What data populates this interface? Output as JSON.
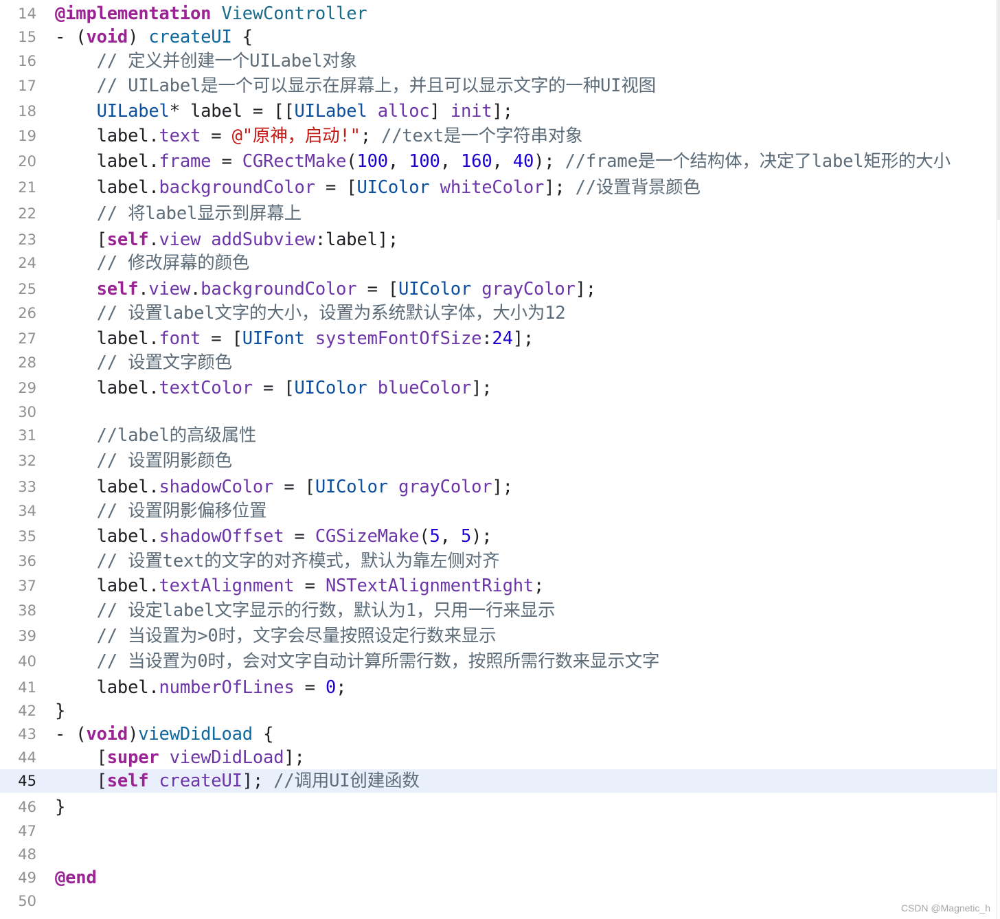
{
  "editor": {
    "lines": [
      {
        "number": "14",
        "tokens": [
          {
            "t": "@implementation",
            "c": "keyword"
          },
          {
            "t": " "
          },
          {
            "t": "ViewController",
            "c": "class"
          }
        ]
      },
      {
        "number": "15",
        "tokens": [
          {
            "t": "- ("
          },
          {
            "t": "void",
            "c": "keyword"
          },
          {
            "t": ") "
          },
          {
            "t": "createUI",
            "c": "decl"
          },
          {
            "t": " {"
          }
        ]
      },
      {
        "number": "16",
        "tokens": [
          {
            "t": "    "
          },
          {
            "t": "// 定义并创建一个UILabel对象",
            "c": "comment"
          }
        ]
      },
      {
        "number": "17",
        "tokens": [
          {
            "t": "    "
          },
          {
            "t": "// UILabel是一个可以显示在屏幕上，并且可以显示文字的一种UI视图",
            "c": "comment"
          }
        ]
      },
      {
        "number": "18",
        "tokens": [
          {
            "t": "    "
          },
          {
            "t": "UILabel",
            "c": "type"
          },
          {
            "t": "* label = [["
          },
          {
            "t": "UILabel",
            "c": "type"
          },
          {
            "t": " "
          },
          {
            "t": "alloc",
            "c": "method"
          },
          {
            "t": "] "
          },
          {
            "t": "init",
            "c": "method"
          },
          {
            "t": "];"
          }
        ]
      },
      {
        "number": "19",
        "tokens": [
          {
            "t": "    label."
          },
          {
            "t": "text",
            "c": "prop"
          },
          {
            "t": " = "
          },
          {
            "t": "@\"原神，启动!\"",
            "c": "string"
          },
          {
            "t": "; "
          },
          {
            "t": "//text是一个字符串对象",
            "c": "comment"
          }
        ]
      },
      {
        "number": "20",
        "tokens": [
          {
            "t": "    label."
          },
          {
            "t": "frame",
            "c": "prop"
          },
          {
            "t": " = "
          },
          {
            "t": "CGRectMake",
            "c": "func"
          },
          {
            "t": "("
          },
          {
            "t": "100",
            "c": "number"
          },
          {
            "t": ", "
          },
          {
            "t": "100",
            "c": "number"
          },
          {
            "t": ", "
          },
          {
            "t": "160",
            "c": "number"
          },
          {
            "t": ", "
          },
          {
            "t": "40",
            "c": "number"
          },
          {
            "t": "); "
          },
          {
            "t": "//frame是一个结构体，决定了label矩形的大小",
            "c": "comment"
          }
        ]
      },
      {
        "number": "21",
        "tokens": [
          {
            "t": "    label."
          },
          {
            "t": "backgroundColor",
            "c": "prop"
          },
          {
            "t": " = ["
          },
          {
            "t": "UIColor",
            "c": "type"
          },
          {
            "t": " "
          },
          {
            "t": "whiteColor",
            "c": "method"
          },
          {
            "t": "]; "
          },
          {
            "t": "//设置背景颜色",
            "c": "comment"
          }
        ]
      },
      {
        "number": "22",
        "tokens": [
          {
            "t": "    "
          },
          {
            "t": "// 将label显示到屏幕上",
            "c": "comment"
          }
        ]
      },
      {
        "number": "23",
        "tokens": [
          {
            "t": "    ["
          },
          {
            "t": "self",
            "c": "keyword"
          },
          {
            "t": "."
          },
          {
            "t": "view",
            "c": "prop"
          },
          {
            "t": " "
          },
          {
            "t": "addSubview",
            "c": "method"
          },
          {
            "t": ":label];"
          }
        ]
      },
      {
        "number": "24",
        "tokens": [
          {
            "t": "    "
          },
          {
            "t": "// 修改屏幕的颜色",
            "c": "comment"
          }
        ]
      },
      {
        "number": "25",
        "tokens": [
          {
            "t": "    "
          },
          {
            "t": "self",
            "c": "keyword"
          },
          {
            "t": "."
          },
          {
            "t": "view",
            "c": "prop"
          },
          {
            "t": "."
          },
          {
            "t": "backgroundColor",
            "c": "prop"
          },
          {
            "t": " = ["
          },
          {
            "t": "UIColor",
            "c": "type"
          },
          {
            "t": " "
          },
          {
            "t": "grayColor",
            "c": "method"
          },
          {
            "t": "];"
          }
        ]
      },
      {
        "number": "26",
        "tokens": [
          {
            "t": "    "
          },
          {
            "t": "// 设置label文字的大小，设置为系统默认字体，大小为12",
            "c": "comment"
          }
        ]
      },
      {
        "number": "27",
        "tokens": [
          {
            "t": "    label."
          },
          {
            "t": "font",
            "c": "prop"
          },
          {
            "t": " = ["
          },
          {
            "t": "UIFont",
            "c": "type"
          },
          {
            "t": " "
          },
          {
            "t": "systemFontOfSize",
            "c": "method"
          },
          {
            "t": ":"
          },
          {
            "t": "24",
            "c": "number"
          },
          {
            "t": "];"
          }
        ]
      },
      {
        "number": "28",
        "tokens": [
          {
            "t": "    "
          },
          {
            "t": "// 设置文字颜色",
            "c": "comment"
          }
        ]
      },
      {
        "number": "29",
        "tokens": [
          {
            "t": "    label."
          },
          {
            "t": "textColor",
            "c": "prop"
          },
          {
            "t": " = ["
          },
          {
            "t": "UIColor",
            "c": "type"
          },
          {
            "t": " "
          },
          {
            "t": "blueColor",
            "c": "method"
          },
          {
            "t": "];"
          }
        ]
      },
      {
        "number": "30",
        "tokens": []
      },
      {
        "number": "31",
        "tokens": [
          {
            "t": "    "
          },
          {
            "t": "//label的高级属性",
            "c": "comment"
          }
        ]
      },
      {
        "number": "32",
        "tokens": [
          {
            "t": "    "
          },
          {
            "t": "// 设置阴影颜色",
            "c": "comment"
          }
        ]
      },
      {
        "number": "33",
        "tokens": [
          {
            "t": "    label."
          },
          {
            "t": "shadowColor",
            "c": "prop"
          },
          {
            "t": " = ["
          },
          {
            "t": "UIColor",
            "c": "type"
          },
          {
            "t": " "
          },
          {
            "t": "grayColor",
            "c": "method"
          },
          {
            "t": "];"
          }
        ]
      },
      {
        "number": "34",
        "tokens": [
          {
            "t": "    "
          },
          {
            "t": "// 设置阴影偏移位置",
            "c": "comment"
          }
        ]
      },
      {
        "number": "35",
        "tokens": [
          {
            "t": "    label."
          },
          {
            "t": "shadowOffset",
            "c": "prop"
          },
          {
            "t": " = "
          },
          {
            "t": "CGSizeMake",
            "c": "func"
          },
          {
            "t": "("
          },
          {
            "t": "5",
            "c": "number"
          },
          {
            "t": ", "
          },
          {
            "t": "5",
            "c": "number"
          },
          {
            "t": ");"
          }
        ]
      },
      {
        "number": "36",
        "tokens": [
          {
            "t": "    "
          },
          {
            "t": "// 设置text的文字的对齐模式，默认为靠左侧对齐",
            "c": "comment"
          }
        ]
      },
      {
        "number": "37",
        "tokens": [
          {
            "t": "    label."
          },
          {
            "t": "textAlignment",
            "c": "prop"
          },
          {
            "t": " = "
          },
          {
            "t": "NSTextAlignmentRight",
            "c": "const"
          },
          {
            "t": ";"
          }
        ]
      },
      {
        "number": "38",
        "tokens": [
          {
            "t": "    "
          },
          {
            "t": "// 设定label文字显示的行数，默认为1，只用一行来显示",
            "c": "comment"
          }
        ]
      },
      {
        "number": "39",
        "tokens": [
          {
            "t": "    "
          },
          {
            "t": "// 当设置为>0时，文字会尽量按照设定行数来显示",
            "c": "comment"
          }
        ]
      },
      {
        "number": "40",
        "tokens": [
          {
            "t": "    "
          },
          {
            "t": "// 当设置为0时，会对文字自动计算所需行数，按照所需行数来显示文字",
            "c": "comment"
          }
        ]
      },
      {
        "number": "41",
        "tokens": [
          {
            "t": "    label."
          },
          {
            "t": "numberOfLines",
            "c": "prop"
          },
          {
            "t": " = "
          },
          {
            "t": "0",
            "c": "number"
          },
          {
            "t": ";"
          }
        ]
      },
      {
        "number": "42",
        "tokens": [
          {
            "t": "}"
          }
        ]
      },
      {
        "number": "43",
        "tokens": [
          {
            "t": "- ("
          },
          {
            "t": "void",
            "c": "keyword"
          },
          {
            "t": ")"
          },
          {
            "t": "viewDidLoad",
            "c": "decl"
          },
          {
            "t": " {"
          }
        ]
      },
      {
        "number": "44",
        "tokens": [
          {
            "t": "    ["
          },
          {
            "t": "super",
            "c": "keyword"
          },
          {
            "t": " "
          },
          {
            "t": "viewDidLoad",
            "c": "method"
          },
          {
            "t": "];"
          }
        ]
      },
      {
        "number": "45",
        "current": true,
        "tokens": [
          {
            "t": "    ["
          },
          {
            "t": "self",
            "c": "keyword"
          },
          {
            "t": " "
          },
          {
            "t": "createUI",
            "c": "method"
          },
          {
            "t": "]; "
          },
          {
            "t": "//调用UI创建函数",
            "c": "comment"
          }
        ]
      },
      {
        "number": "46",
        "tokens": [
          {
            "t": "}"
          }
        ]
      },
      {
        "number": "47",
        "tokens": []
      },
      {
        "number": "48",
        "tokens": []
      },
      {
        "number": "49",
        "tokens": [
          {
            "t": "@end",
            "c": "keyword"
          }
        ]
      },
      {
        "number": "50",
        "tokens": []
      }
    ]
  },
  "watermark": "CSDN @Magnetic_h",
  "colors": {
    "keyword": "#9b2393",
    "type": "#0b4f9e",
    "method": "#6c36a9",
    "number": "#1c00cf",
    "string": "#c41a16",
    "comment": "#5d6c79",
    "current_line_bg": "#e9f0fb"
  }
}
